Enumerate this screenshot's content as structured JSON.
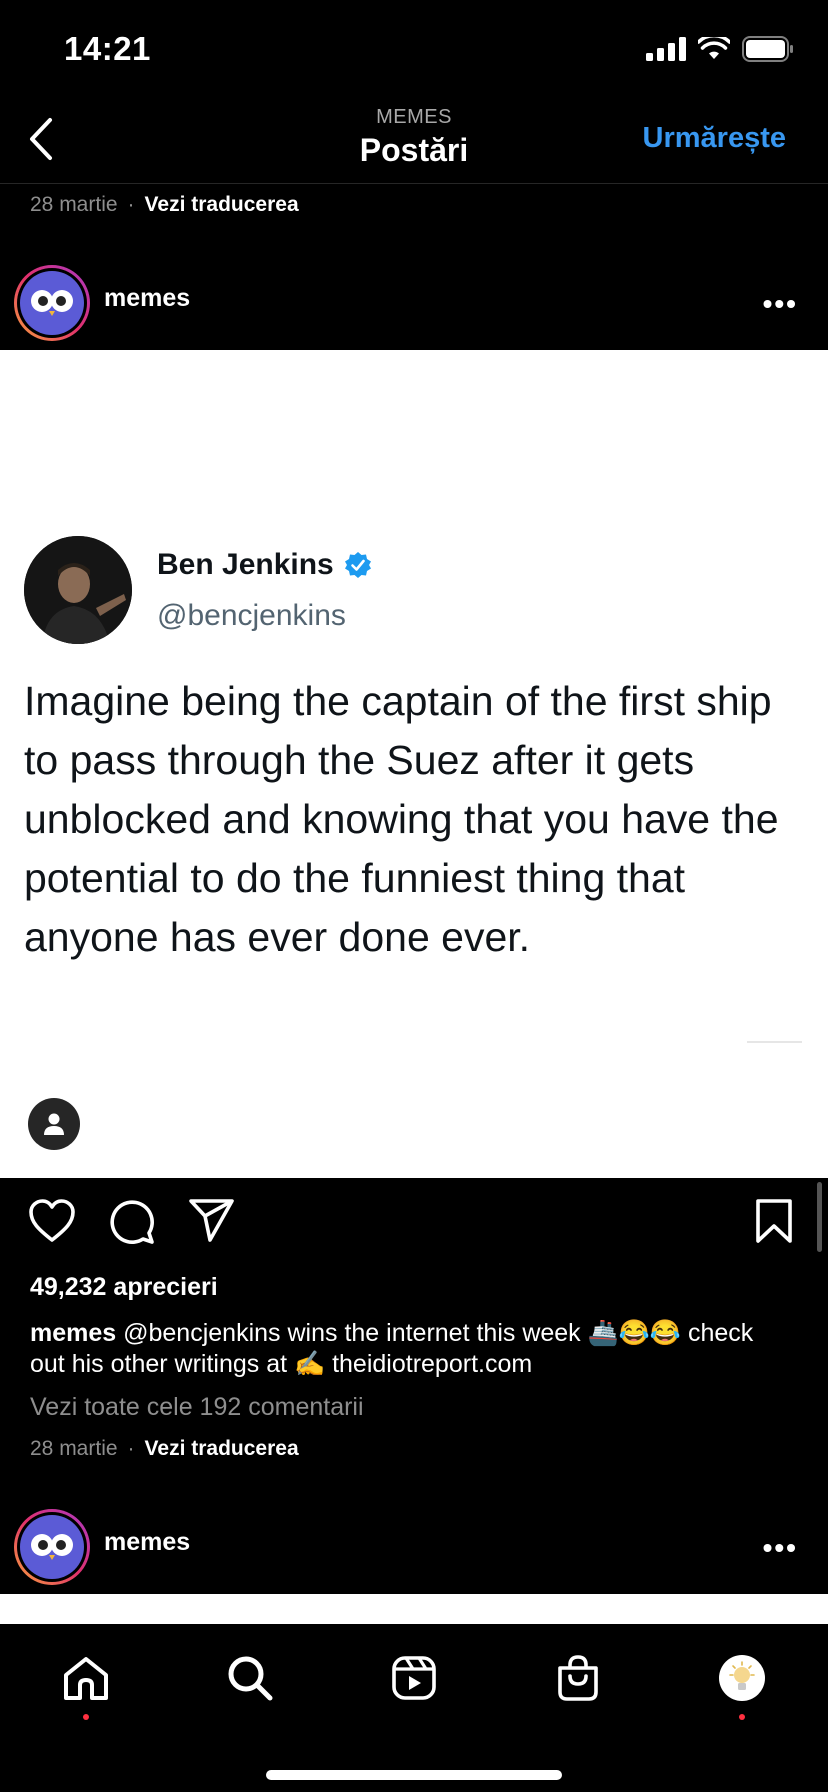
{
  "status": {
    "time": "14:21"
  },
  "nav": {
    "subtitle": "MEMES",
    "title": "Postări",
    "follow_label": "Urmărește"
  },
  "top_meta": {
    "date": "28 martie",
    "separator": "·",
    "translate": "Vezi traducerea"
  },
  "post": {
    "username": "memes",
    "more_label": "•••",
    "tweet": {
      "name": "Ben Jenkins",
      "handle": "@bencjenkins",
      "text": "Imagine being the captain of the first ship to pass through the Suez after it gets unblocked and knowing that you have the potential to do the funniest thing that anyone has ever done ever."
    },
    "likes": "49,232 aprecieri",
    "caption_user": "memes",
    "caption_text": "@bencjenkins wins the internet this week 🚢😂😂 check out his other writings at ✍️ theidiotreport.com",
    "comments_link": "Vezi toate cele 192 comentarii",
    "date": "28 martie",
    "separator": "·",
    "translate": "Vezi traducerea"
  },
  "next_post": {
    "username": "memes",
    "more_label": "•••"
  },
  "tabbar": {
    "items": [
      "home",
      "search",
      "reels",
      "shop",
      "profile"
    ]
  },
  "colors": {
    "accent": "#3897f0",
    "verified": "#1d9bf0",
    "notification": "#ff3040"
  }
}
